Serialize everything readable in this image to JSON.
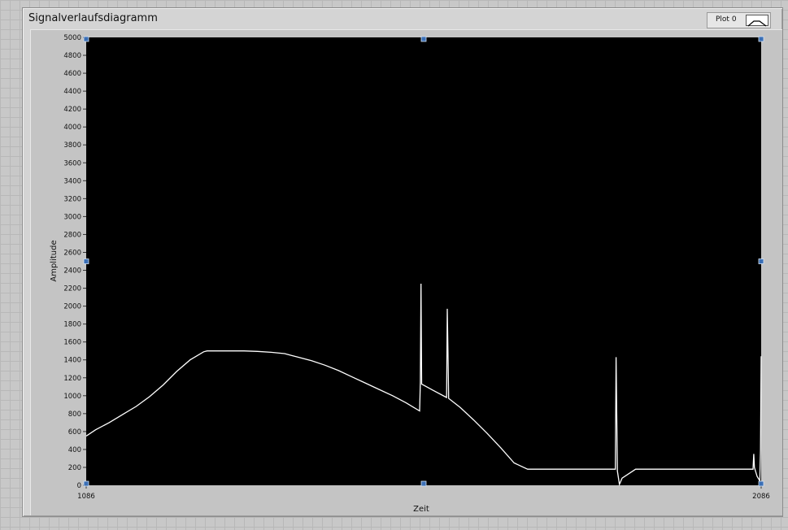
{
  "chart_data": {
    "type": "line",
    "title": "Signalverlaufsdiagramm",
    "xlabel": "Zeit",
    "ylabel": "Amplitude",
    "xlim": [
      1086,
      2086
    ],
    "ylim": [
      0,
      5000
    ],
    "x_ticks": [
      "1086",
      "2086"
    ],
    "y_ticks": [
      "0",
      "200",
      "400",
      "600",
      "800",
      "1000",
      "1200",
      "1400",
      "1600",
      "1800",
      "2000",
      "2200",
      "2400",
      "2600",
      "2800",
      "3000",
      "3200",
      "3400",
      "3600",
      "3800",
      "4000",
      "4200",
      "4400",
      "4600",
      "4800",
      "5000"
    ],
    "legend": {
      "position": "top-right"
    },
    "series": [
      {
        "name": "Plot 0",
        "x": [
          1086,
          1100,
          1120,
          1140,
          1160,
          1180,
          1200,
          1220,
          1240,
          1260,
          1265,
          1280,
          1300,
          1320,
          1340,
          1360,
          1380,
          1390,
          1400,
          1420,
          1440,
          1460,
          1480,
          1500,
          1520,
          1540,
          1560,
          1580,
          1581,
          1582,
          1583,
          1600,
          1620,
          1621,
          1622,
          1623,
          1640,
          1660,
          1680,
          1700,
          1720,
          1740,
          1760,
          1765,
          1780,
          1800,
          1820,
          1840,
          1860,
          1870,
          1871,
          1872,
          1873,
          1876,
          1880,
          1900,
          1920,
          1940,
          1960,
          1980,
          2000,
          2040,
          2070,
          2074,
          2075,
          2076,
          2080,
          2084,
          2085,
          2086
        ],
        "y": [
          550,
          620,
          700,
          790,
          880,
          990,
          1120,
          1270,
          1400,
          1490,
          1500,
          1500,
          1500,
          1500,
          1495,
          1485,
          1470,
          1450,
          1430,
          1390,
          1340,
          1280,
          1210,
          1140,
          1070,
          1000,
          920,
          830,
          1150,
          2250,
          1130,
          1060,
          980,
          1970,
          1470,
          970,
          870,
          730,
          580,
          420,
          250,
          180,
          180,
          180,
          180,
          180,
          180,
          180,
          180,
          180,
          1430,
          800,
          160,
          10,
          80,
          180,
          180,
          180,
          180,
          180,
          180,
          180,
          180,
          180,
          350,
          200,
          100,
          50,
          400,
          1440
        ]
      }
    ]
  },
  "legend": {
    "label": "Plot 0",
    "line_color": "#000000"
  },
  "colors": {
    "plot_background": "#000000",
    "trace": "#ffffff",
    "handle": "#3b6fb6"
  }
}
